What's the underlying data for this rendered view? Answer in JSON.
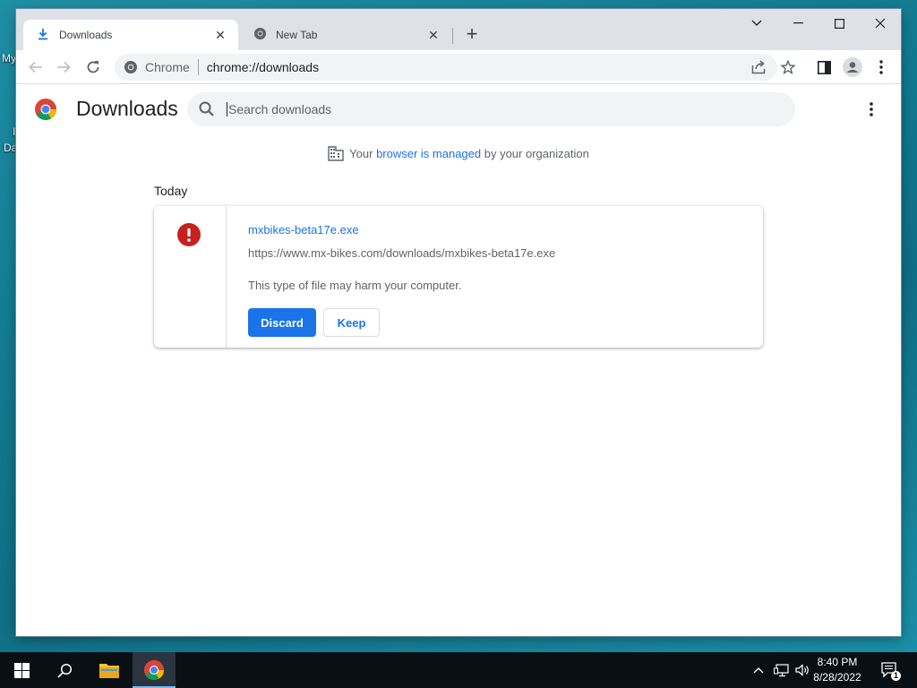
{
  "desktop": {
    "icon_labels": [
      "My",
      "I",
      "Da"
    ]
  },
  "browser": {
    "tabs": [
      {
        "title": "Downloads",
        "icon": "download-icon",
        "active": true
      },
      {
        "title": "New Tab",
        "icon": "chrome-globe-icon",
        "active": false
      }
    ],
    "new_tab_glyph": "+",
    "window_controls": {
      "dropdown": "⌄",
      "minimize": "—",
      "maximize": "☐",
      "close": "✕"
    },
    "toolbar": {
      "back": "←",
      "forward": "→",
      "reload": "↻",
      "chip_label": "Chrome",
      "url_path": "chrome://downloads"
    }
  },
  "downloads_page": {
    "title": "Downloads",
    "search_placeholder": "Search downloads",
    "managed": {
      "prefix": "Your ",
      "link": "browser is managed",
      "suffix": " by your organization"
    },
    "date_heading": "Today",
    "items": [
      {
        "file_name": "mxbikes-beta17e.exe",
        "url": "https://www.mx-bikes.com/downloads/mxbikes-beta17e.exe",
        "warning": "This type of file may harm your computer.",
        "discard_label": "Discard",
        "keep_label": "Keep"
      }
    ]
  },
  "taskbar": {
    "clock_time": "8:40 PM",
    "clock_date": "8/28/2022",
    "notification_count": "1"
  },
  "colors": {
    "accent": "#1a73e8",
    "warning_red": "#c5221f",
    "taskbar": "#0a0f14"
  }
}
